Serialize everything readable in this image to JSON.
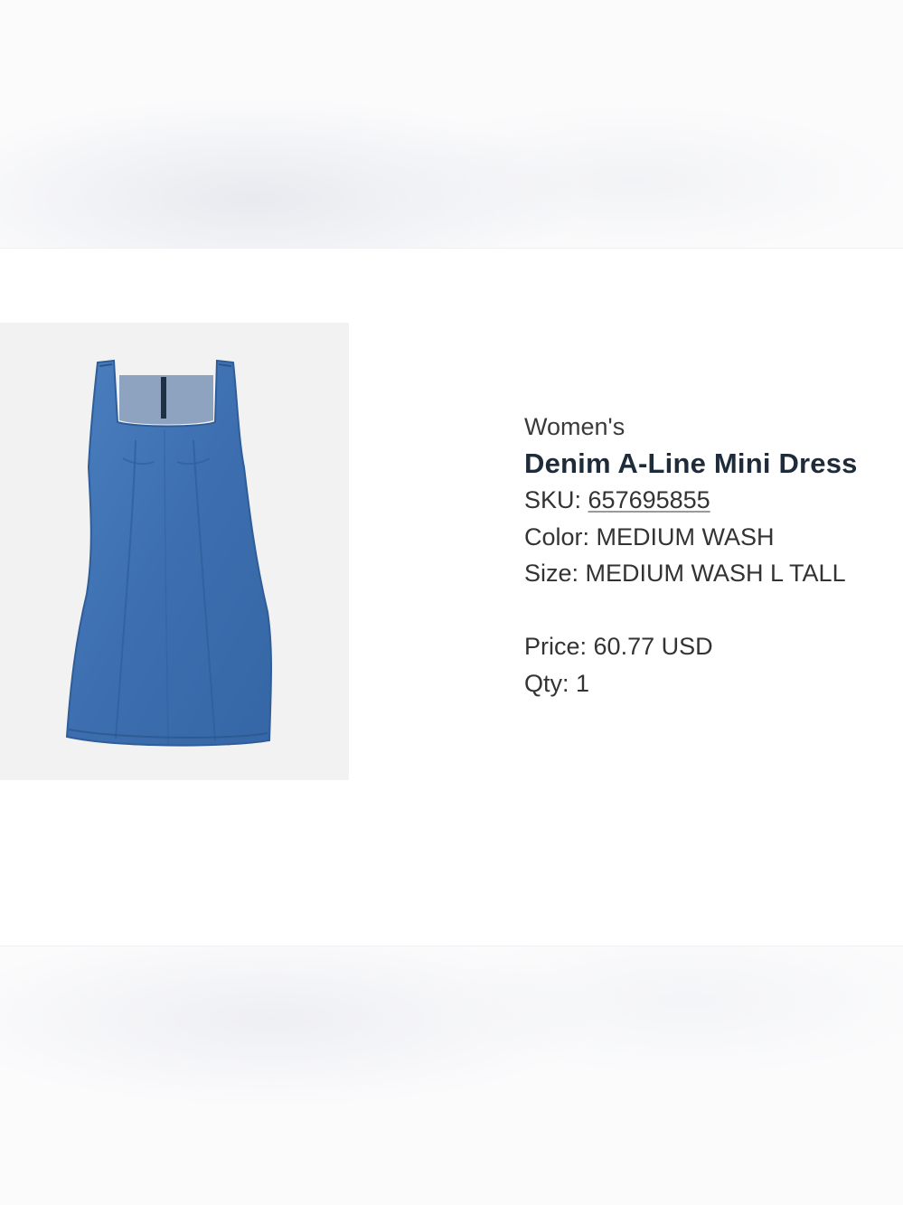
{
  "product": {
    "category": "Women's",
    "name": "Denim A-Line Mini Dress",
    "sku_label": "SKU:",
    "sku_value": "657695855",
    "color_label": "Color:",
    "color_value": "MEDIUM WASH",
    "size_label": "Size:",
    "size_value": "MEDIUM WASH L TALL",
    "price_label": "Price:",
    "price_value": "60.77 USD",
    "qty_label": "Qty:",
    "qty_value": "1"
  },
  "colors": {
    "denim": "#3f73b3",
    "image_background": "#f2f2f3",
    "title_text": "#1e2b3a",
    "body_text": "#333333"
  },
  "icons": {
    "product_image": "denim-dress-image"
  }
}
